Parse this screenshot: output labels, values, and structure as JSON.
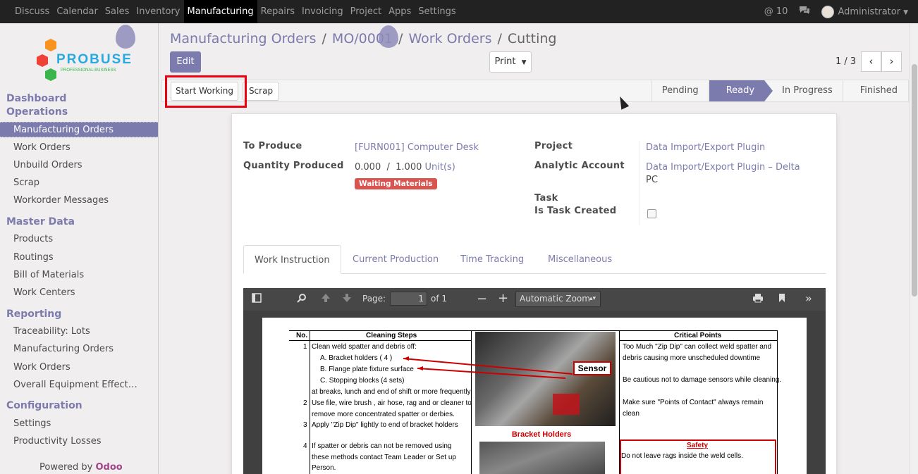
{
  "topnav": {
    "items": [
      "Discuss",
      "Calendar",
      "Sales",
      "Inventory",
      "Manufacturing",
      "Repairs",
      "Invoicing",
      "Project",
      "Apps",
      "Settings"
    ],
    "active": "Manufacturing",
    "notif_count": "10",
    "user": "Administrator"
  },
  "logo": {
    "name": "PROBUSE",
    "tagline": "PROFESSIONAL BUSINESS"
  },
  "sidebar": {
    "section1a": "Dashboard",
    "section1b": "Operations",
    "ops": [
      "Manufacturing Orders",
      "Work Orders",
      "Unbuild Orders",
      "Scrap",
      "Workorder Messages"
    ],
    "master_title": "Master Data",
    "master": [
      "Products",
      "Routings",
      "Bill of Materials",
      "Work Centers"
    ],
    "reporting_title": "Reporting",
    "reporting": [
      "Traceability: Lots",
      "Manufacturing Orders",
      "Work Orders",
      "Overall Equipment Effect…"
    ],
    "config_title": "Configuration",
    "config": [
      "Settings",
      "Productivity Losses"
    ],
    "powered_by": "Powered by",
    "powered_brand": "Odoo"
  },
  "breadcrumb": {
    "b1": "Manufacturing Orders",
    "b2": "MO/0001",
    "b3": "Work Orders",
    "current": "Cutting",
    "sep": "/"
  },
  "controls": {
    "edit": "Edit",
    "print": "Print",
    "pager": "1 / 3"
  },
  "statusbar": {
    "start": "Start Working",
    "scrap": "Scrap",
    "stages": [
      "Pending",
      "Ready",
      "In Progress",
      "Finished"
    ],
    "active_stage": "Ready"
  },
  "form": {
    "to_produce_label": "To Produce",
    "to_produce": "[FURN001] Computer Desk",
    "qty_label": "Quantity Produced",
    "qty_done": "0.000",
    "qty_sep": "/",
    "qty_total": "1.000",
    "qty_uom": "Unit(s)",
    "badge": "Waiting Materials",
    "project_label": "Project",
    "project": "Data Import/Export Plugin",
    "analytic_label": "Analytic Account",
    "analytic": "Data Import/Export Plugin – Delta",
    "analytic_code": "PC",
    "task_label": "Task",
    "task_created_label": "Is Task Created"
  },
  "tabs": [
    "Work Instruction",
    "Current Production",
    "Time Tracking",
    "Miscellaneous"
  ],
  "pdf": {
    "page_label": "Page:",
    "page_value": "1",
    "of": "of 1",
    "zoom": "Automatic Zoom",
    "doc": {
      "col_no": "No.",
      "col_steps": "Cleaning Steps",
      "col_critical": "Critical Points",
      "rows": [
        "Clean weld spatter and debris off:",
        "A. Bracket holders ( 4 )",
        "B. Flange plate fixture surface",
        "C. Stopping blocks (4 sets)",
        "at breaks, lunch and end of shift or more frequently",
        "Use file, wire brush , air hose, rag and or cleaner to",
        "remove more concentrated spatter or derbies.",
        "Apply \"Zip Dip\" lightly to end of bracket holders",
        "If spatter or debris can not be removed using",
        "these methods contact Team Leader or Set up",
        "Person."
      ],
      "nums": [
        "1",
        "2",
        "3",
        "4"
      ],
      "critical": [
        "Too Much \"Zip Dip\" can collect weld spatter and",
        "debris causing more unscheduled downtime",
        "Be cautious not to damage sensors while cleaning.",
        "Make sure \"Points of Contact\" always remain",
        "clean"
      ],
      "sensor": "Sensor",
      "bracket": "Bracket Holders",
      "safety": "Safety",
      "safety_text": "Do not leave rags inside the weld cells."
    }
  }
}
